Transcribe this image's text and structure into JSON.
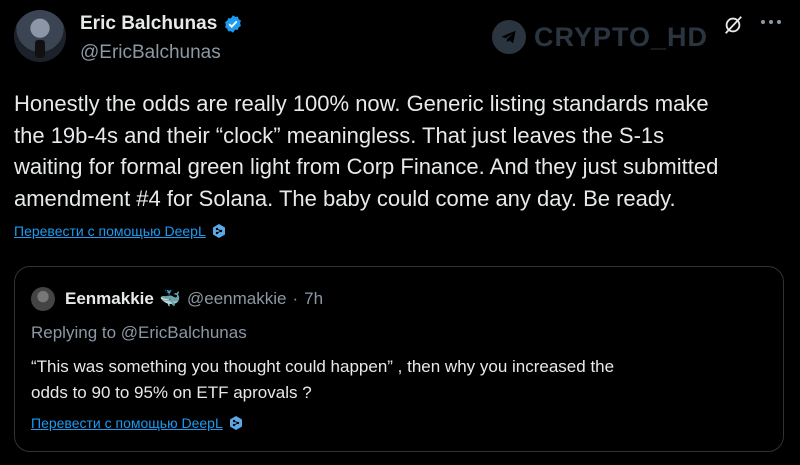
{
  "tweet": {
    "author_name": "Eric Balchunas",
    "author_handle": "@EricBalchunas",
    "lines": [
      "Honestly the odds are really 100% now. Generic listing standards make",
      "the 19b-4s and their “clock” meaningless. That just leaves the S-1s",
      "waiting for formal green light from Corp Finance. And they just submitted",
      "amendment #4 for Solana. The baby could come any day. Be ready."
    ],
    "translate_label": "Перевести с помощью DeepL"
  },
  "watermark": {
    "text": "CRYPTO_HD"
  },
  "quote": {
    "author_name": "Eenmakkie",
    "author_emoji": "🐳",
    "author_handle": "@eenmakkie",
    "separator": "·",
    "time": "7h",
    "replying_to": "Replying to @EricBalchunas",
    "lines": [
      "“This was something you thought could happen” , then why you increased the",
      "odds to 90 to 95% on ETF aprovals ?"
    ],
    "translate_label": "Перевести с помощью DeepL"
  },
  "colors": {
    "background": "#000000",
    "text": "#e7e9ea",
    "muted": "#8b98a5",
    "link": "#1d9bf0",
    "verified": "#1d9bf0"
  }
}
